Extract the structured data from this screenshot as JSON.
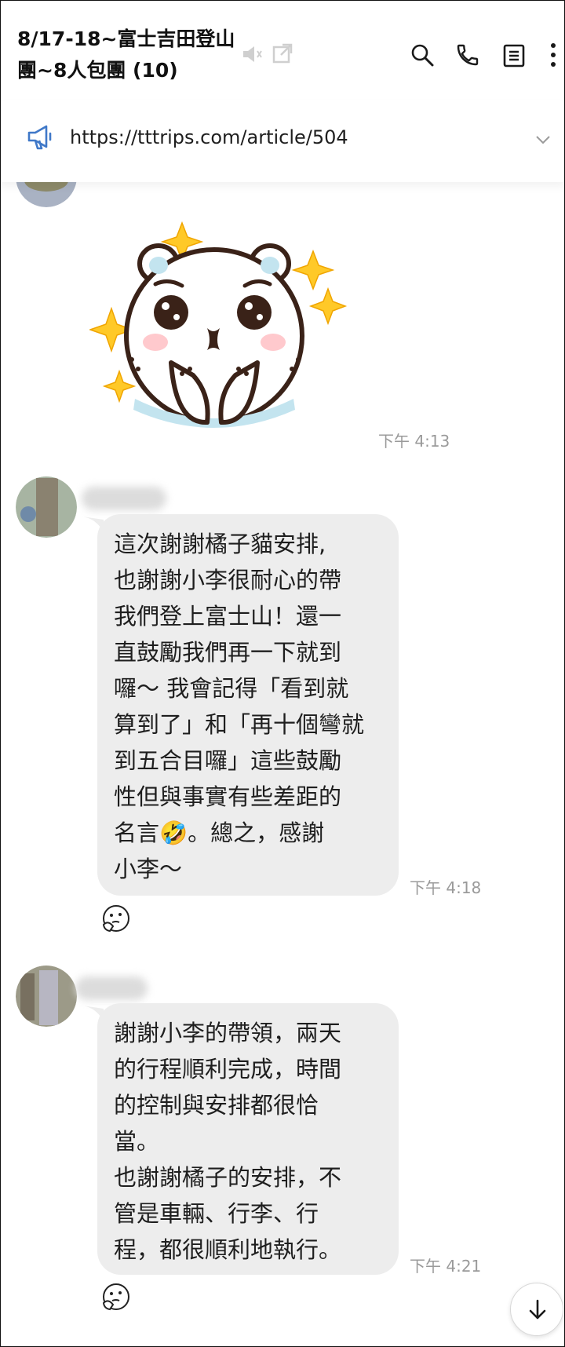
{
  "header": {
    "title": "8/17-18~富士吉田登山團~8人包團 (10)",
    "icons": [
      "mute-icon",
      "open-external-icon",
      "search-icon",
      "phone-icon",
      "notes-icon",
      "more-icon"
    ]
  },
  "announcement": {
    "text": "https://tttrips.com/article/504",
    "icon": "megaphone-icon"
  },
  "messages": [
    {
      "type": "sticker",
      "sticker": "white-bear-with-sparkles",
      "time": "下午 4:13"
    },
    {
      "type": "text",
      "text": "這次謝謝橘子貓安排,\n也謝謝小李很耐心的帶\n我們登上富士山！還一\n直鼓勵我們再一下就到\n囉～ 我會記得「看到就\n算到了」和「再十個彎就\n到五合目囉」這些鼓勵\n性但與事實有些差距的\n名言🤣。總之，感謝\n小李～",
      "time": "下午 4:18",
      "reaction": "thinking-face-emoji"
    },
    {
      "type": "text",
      "text": "謝謝小李的帶領，兩天\n的行程順利完成，時間\n的控制與安排都很恰\n當。\n也謝謝橘子的安排，不\n管是車輛、行李、行\n程，都很順利地執行。",
      "time": "下午 4:21",
      "reaction": "thinking-face-emoji"
    }
  ],
  "colors": {
    "bubble": "#ededed",
    "accent": "#3f78c8",
    "timestamp": "#9a9a9a",
    "sparkle": "#ffc928"
  }
}
